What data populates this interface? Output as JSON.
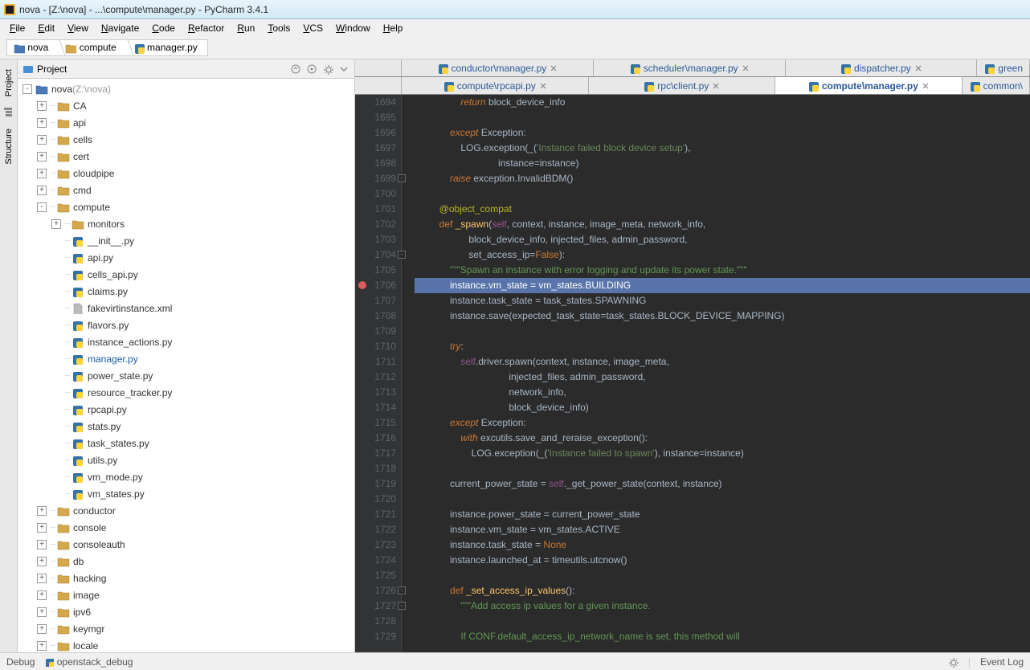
{
  "title_bar": {
    "text": "nova - [Z:\\nova] - ...\\compute\\manager.py - PyCharm 3.4.1"
  },
  "menu": [
    "File",
    "Edit",
    "View",
    "Navigate",
    "Code",
    "Refactor",
    "Run",
    "Tools",
    "VCS",
    "Window",
    "Help"
  ],
  "breadcrumbs": [
    {
      "label": "nova",
      "kind": "folder-blue"
    },
    {
      "label": "compute",
      "kind": "folder"
    },
    {
      "label": "manager.py",
      "kind": "py"
    }
  ],
  "left_strip": {
    "tabs": [
      "Project",
      "Structure"
    ]
  },
  "project_panel": {
    "title": "Project",
    "root": {
      "label": "nova",
      "hint": "(Z:\\nova)"
    },
    "tree": [
      {
        "depth": 0,
        "toggle": "-",
        "icon": "folder-blue",
        "label": "nova",
        "hint": "(Z:\\nova)"
      },
      {
        "depth": 1,
        "toggle": "+",
        "icon": "folder",
        "label": "CA"
      },
      {
        "depth": 1,
        "toggle": "+",
        "icon": "folder",
        "label": "api"
      },
      {
        "depth": 1,
        "toggle": "+",
        "icon": "folder",
        "label": "cells"
      },
      {
        "depth": 1,
        "toggle": "+",
        "icon": "folder",
        "label": "cert"
      },
      {
        "depth": 1,
        "toggle": "+",
        "icon": "folder",
        "label": "cloudpipe"
      },
      {
        "depth": 1,
        "toggle": "+",
        "icon": "folder",
        "label": "cmd"
      },
      {
        "depth": 1,
        "toggle": "-",
        "icon": "folder",
        "label": "compute"
      },
      {
        "depth": 2,
        "toggle": "+",
        "icon": "folder",
        "label": "monitors"
      },
      {
        "depth": 2,
        "toggle": "",
        "icon": "py",
        "label": "__init__.py"
      },
      {
        "depth": 2,
        "toggle": "",
        "icon": "py",
        "label": "api.py"
      },
      {
        "depth": 2,
        "toggle": "",
        "icon": "py",
        "label": "cells_api.py"
      },
      {
        "depth": 2,
        "toggle": "",
        "icon": "py",
        "label": "claims.py"
      },
      {
        "depth": 2,
        "toggle": "",
        "icon": "file",
        "label": "fakevirtinstance.xml"
      },
      {
        "depth": 2,
        "toggle": "",
        "icon": "py",
        "label": "flavors.py"
      },
      {
        "depth": 2,
        "toggle": "",
        "icon": "py",
        "label": "instance_actions.py"
      },
      {
        "depth": 2,
        "toggle": "",
        "icon": "py",
        "label": "manager.py",
        "selected": true
      },
      {
        "depth": 2,
        "toggle": "",
        "icon": "py",
        "label": "power_state.py"
      },
      {
        "depth": 2,
        "toggle": "",
        "icon": "py",
        "label": "resource_tracker.py"
      },
      {
        "depth": 2,
        "toggle": "",
        "icon": "py",
        "label": "rpcapi.py"
      },
      {
        "depth": 2,
        "toggle": "",
        "icon": "py",
        "label": "stats.py"
      },
      {
        "depth": 2,
        "toggle": "",
        "icon": "py",
        "label": "task_states.py"
      },
      {
        "depth": 2,
        "toggle": "",
        "icon": "py",
        "label": "utils.py"
      },
      {
        "depth": 2,
        "toggle": "",
        "icon": "py",
        "label": "vm_mode.py"
      },
      {
        "depth": 2,
        "toggle": "",
        "icon": "py",
        "label": "vm_states.py"
      },
      {
        "depth": 1,
        "toggle": "+",
        "icon": "folder",
        "label": "conductor"
      },
      {
        "depth": 1,
        "toggle": "+",
        "icon": "folder",
        "label": "console"
      },
      {
        "depth": 1,
        "toggle": "+",
        "icon": "folder",
        "label": "consoleauth"
      },
      {
        "depth": 1,
        "toggle": "+",
        "icon": "folder",
        "label": "db"
      },
      {
        "depth": 1,
        "toggle": "+",
        "icon": "folder",
        "label": "hacking"
      },
      {
        "depth": 1,
        "toggle": "+",
        "icon": "folder",
        "label": "image"
      },
      {
        "depth": 1,
        "toggle": "+",
        "icon": "folder",
        "label": "ipv6"
      },
      {
        "depth": 1,
        "toggle": "+",
        "icon": "folder",
        "label": "keymgr"
      },
      {
        "depth": 1,
        "toggle": "+",
        "icon": "folder",
        "label": "locale"
      }
    ]
  },
  "editor_tabs_row1": [
    {
      "label": "conductor\\manager.py",
      "close": true
    },
    {
      "label": "scheduler\\manager.py",
      "close": true
    },
    {
      "label": "dispatcher.py",
      "close": true
    },
    {
      "label": "green",
      "close": false,
      "partial": true
    }
  ],
  "editor_tabs_row2": [
    {
      "label": "compute\\rpcapi.py",
      "close": true
    },
    {
      "label": "rpc\\client.py",
      "close": true
    },
    {
      "label": "compute\\manager.py",
      "close": true,
      "active": true
    },
    {
      "label": "common\\",
      "close": false,
      "partial": true
    }
  ],
  "code": {
    "first_line": 1694,
    "highlighted_line": 1706,
    "breakpoint_line": 1706,
    "lines": [
      {
        "n": 1694,
        "html": "                <span class='kw'>return</span> block_device_info"
      },
      {
        "n": 1695,
        "html": ""
      },
      {
        "n": 1696,
        "html": "            <span class='kw'>except</span> Exception:"
      },
      {
        "n": 1697,
        "html": "                LOG.exception(_(<span class='str'>'Instance failed block device setup'</span>),"
      },
      {
        "n": 1698,
        "html": "                              <span class='param'>instance</span>=instance)"
      },
      {
        "n": 1699,
        "html": "            <span class='kw'>raise</span> exception.InvalidBDM()",
        "fold": "-"
      },
      {
        "n": 1700,
        "html": ""
      },
      {
        "n": 1701,
        "html": "        <span class='dec'>@object_compat</span>"
      },
      {
        "n": 1702,
        "html": "        <span class='kw-ni'>def</span> <span class='fn'>_spawn</span>(<span class='self'>self</span>, context, instance, image_meta, network_info,"
      },
      {
        "n": 1703,
        "html": "                   block_device_info, injected_files, admin_password,"
      },
      {
        "n": 1704,
        "html": "                   <span class='param'>set_access_ip</span>=<span class='kw-ni'>False</span>):",
        "fold": "-"
      },
      {
        "n": 1705,
        "html": "            <span class='docstr'>\"\"\"Spawn an instance with error logging and update its power state.\"\"\"</span>"
      },
      {
        "n": 1706,
        "html": "            instance.vm_state = vm_states.BUILDING",
        "hl": true,
        "bp": true
      },
      {
        "n": 1707,
        "html": "            instance.task_state = task_states.SPAWNING"
      },
      {
        "n": 1708,
        "html": "            instance.save(<span class='param'>expected_task_state</span>=task_states.BLOCK_DEVICE_MAPPING)"
      },
      {
        "n": 1709,
        "html": ""
      },
      {
        "n": 1710,
        "html": "            <span class='kw'>try</span>:"
      },
      {
        "n": 1711,
        "html": "                <span class='self'>self</span>.driver.spawn(context, instance, image_meta,"
      },
      {
        "n": 1712,
        "html": "                                  injected_files, admin_password,"
      },
      {
        "n": 1713,
        "html": "                                  network_info,"
      },
      {
        "n": 1714,
        "html": "                                  block_device_info)"
      },
      {
        "n": 1715,
        "html": "            <span class='kw'>except</span> Exception:"
      },
      {
        "n": 1716,
        "html": "                <span class='kw'>with</span> excutils.save_and_reraise_exception():"
      },
      {
        "n": 1717,
        "html": "                    LOG.exception(_(<span class='str'>'Instance failed to spawn'</span>), <span class='param'>instance</span>=instance)"
      },
      {
        "n": 1718,
        "html": ""
      },
      {
        "n": 1719,
        "html": "            current_power_state = <span class='self'>self</span>._get_power_state(context, instance)"
      },
      {
        "n": 1720,
        "html": ""
      },
      {
        "n": 1721,
        "html": "            instance.power_state = current_power_state"
      },
      {
        "n": 1722,
        "html": "            instance.vm_state = vm_states.ACTIVE"
      },
      {
        "n": 1723,
        "html": "            instance.task_state = <span class='kw-ni'>None</span>"
      },
      {
        "n": 1724,
        "html": "            instance.launched_at = timeutils.utcnow()"
      },
      {
        "n": 1725,
        "html": ""
      },
      {
        "n": 1726,
        "html": "            <span class='kw-ni'>def</span> <span class='fn'>_set_access_ip_values</span>():",
        "fold": "-"
      },
      {
        "n": 1727,
        "html": "                <span class='docstr'>\"\"\"Add access ip values for a given instance.</span>",
        "fold": "-"
      },
      {
        "n": 1728,
        "html": ""
      },
      {
        "n": 1729,
        "html": "<span class='docstr'>                If CONF.default_access_ip_network_name is set, this method will</span>"
      }
    ]
  },
  "status_bar": {
    "left": [
      "Debug",
      "openstack_debug"
    ],
    "right": [
      "Event Log"
    ]
  }
}
